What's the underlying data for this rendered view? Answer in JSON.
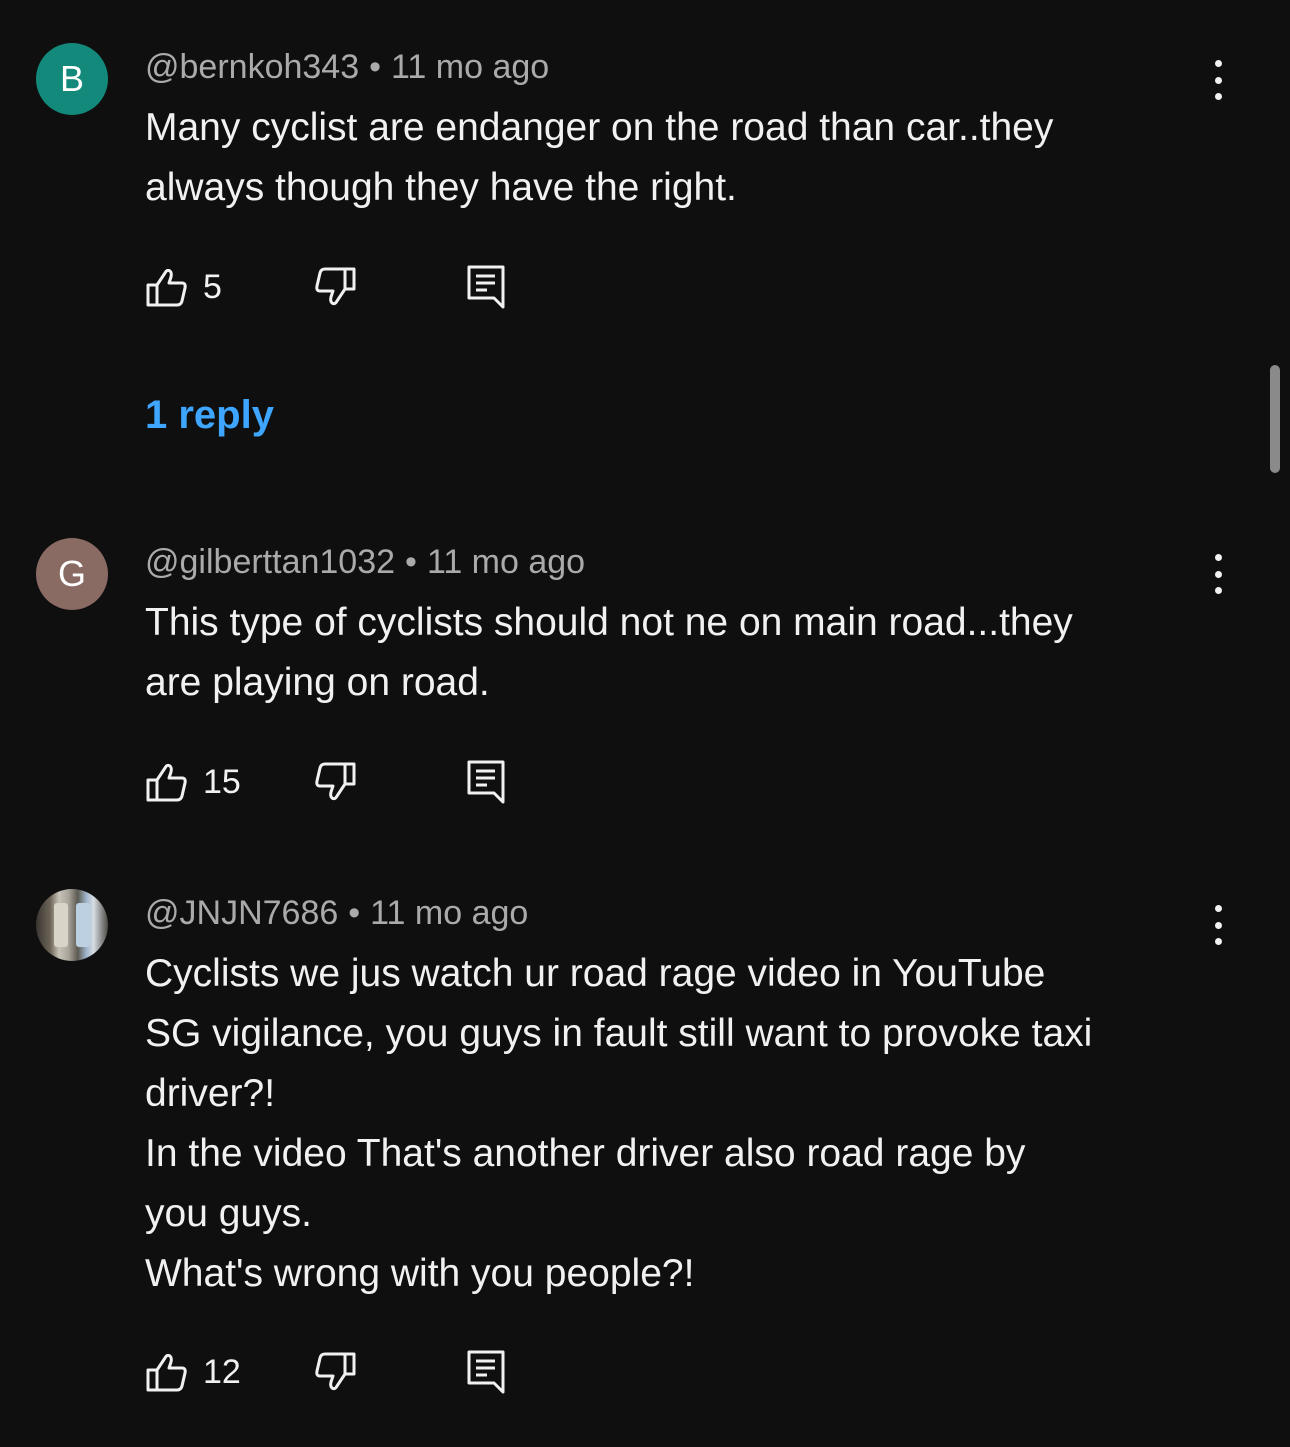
{
  "colors": {
    "background": "#0f0f0f",
    "text_primary": "#f1f1f1",
    "text_secondary": "#aaaaaa",
    "link": "#3ea6ff"
  },
  "comments": [
    {
      "avatar_letter": "B",
      "avatar_color": "#12897a",
      "username": "@bernkoh343",
      "separator": "•",
      "timestamp": "11 mo ago",
      "text": "Many cyclist are endanger on the road than car..they\nalways though they have the right.",
      "like_count": "5",
      "icons": {
        "like": "thumbs-up-icon",
        "dislike": "thumbs-down-icon",
        "reply": "reply-comment-icon",
        "menu": "more-vertical-icon"
      },
      "replies_label": "1 reply"
    },
    {
      "avatar_letter": "G",
      "avatar_color": "#8a6b63",
      "username": "@gilberttan1032",
      "separator": "•",
      "timestamp": "11 mo ago",
      "text": "This type of cyclists should not ne on main road...they\nare playing on road.",
      "like_count": "15",
      "icons": {
        "like": "thumbs-up-icon",
        "dislike": "thumbs-down-icon",
        "reply": "reply-comment-icon",
        "menu": "more-vertical-icon"
      }
    },
    {
      "avatar_letter": "",
      "avatar_kind": "photo",
      "username": "@JNJN7686",
      "separator": "•",
      "timestamp": "11 mo ago",
      "text": "Cyclists we jus watch ur road rage video in YouTube\nSG vigilance, you guys in fault still want to provoke taxi\ndriver?!\nIn the video That's another driver also road rage by\nyou guys.\nWhat's wrong with you people?!",
      "like_count": "12",
      "icons": {
        "like": "thumbs-up-icon",
        "dislike": "thumbs-down-icon",
        "reply": "reply-comment-icon",
        "menu": "more-vertical-icon"
      }
    }
  ]
}
